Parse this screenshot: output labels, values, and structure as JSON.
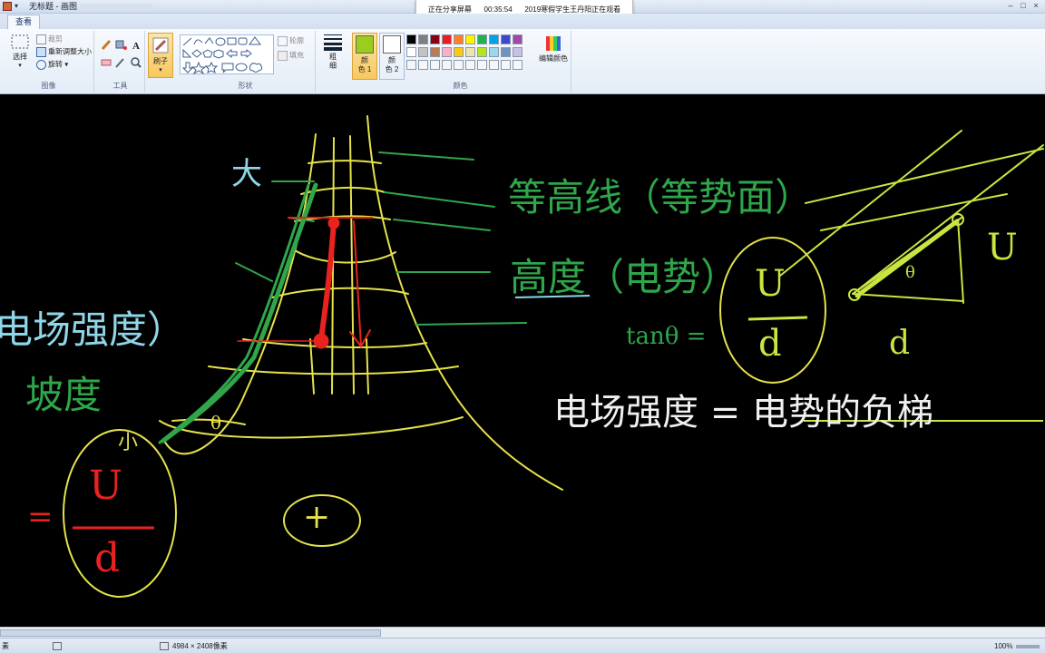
{
  "window": {
    "title": "无标题 - 画图",
    "controls": [
      "–",
      "□",
      "×"
    ]
  },
  "share_banner": {
    "status": "正在分享屏幕",
    "time": "00:35:54",
    "viewer": "2019寒假学生王丹阳正在观看"
  },
  "ribbon": {
    "tab": "查看",
    "image": {
      "select": "选择",
      "crop": "裁剪",
      "resize": "重新调整大小",
      "rotate": "旋转",
      "label": "图像"
    },
    "tools": {
      "label": "工具",
      "text_tool": "A"
    },
    "brushes": {
      "label": "刷子"
    },
    "shapes": {
      "label": "形状",
      "outline": "轮廓",
      "fill": "填充"
    },
    "size": {
      "label_line1": "粗",
      "label_line2": "细"
    },
    "colors": {
      "label": "颜色",
      "color1_line1": "颜",
      "color1_line2": "色 1",
      "color2_line1": "颜",
      "color2_line2": "色 2",
      "edit": "编辑颜色",
      "color1_value": "#9acd1c",
      "color2_value": "#ffffff",
      "palette": [
        "#000000",
        "#7f7f7f",
        "#880015",
        "#ed1c24",
        "#ff7f27",
        "#fff200",
        "#22b14c",
        "#00a2e8",
        "#3f48cc",
        "#a349a4",
        "#ffffff",
        "#c3c3c3",
        "#b97a57",
        "#ffaec9",
        "#ffc90e",
        "#efe4b0",
        "#b5e61d",
        "#99d9ea",
        "#7092be",
        "#c8bfe7"
      ]
    }
  },
  "canvas": {
    "notes": {
      "big": "大",
      "small": "小",
      "equipotential": "等高线（等势面）",
      "height": "高度（电势）",
      "field_left": "电场强度）",
      "slope": "坡度",
      "field_def": "电场强度 = 电势的负梯",
      "theta": "θ",
      "theta2": "θ",
      "tan": "tanθ =",
      "d_label": "d",
      "u_label": "U",
      "frac_num": "U",
      "frac_den": "d",
      "frac_num2": "U",
      "frac_den2": "d",
      "plus": "+",
      "equal_left": "="
    },
    "ink_colors": {
      "yellow": "#e5e24a",
      "green": "#2fa64a",
      "cyan": "#8fd6e8",
      "red": "#e8231f",
      "white": "#f0f0f0",
      "lime": "#c8e640"
    }
  },
  "status_bar": {
    "left_text": "素",
    "dimensions": "4984 × 2408像素",
    "zoom": "100%"
  }
}
